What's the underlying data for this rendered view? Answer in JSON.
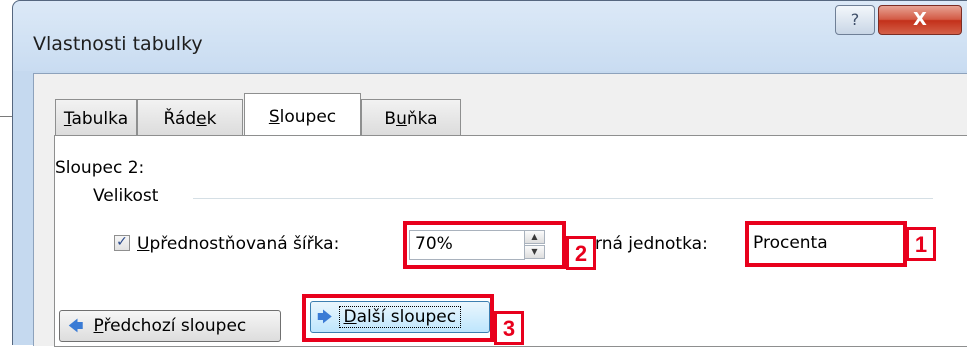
{
  "window": {
    "title": "Vlastnosti tabulky",
    "help_glyph": "?",
    "close_glyph": "X"
  },
  "tabs": [
    {
      "label": "Tabulka",
      "hotkey_index": 0,
      "active": false
    },
    {
      "label": "Řádek",
      "hotkey_index": 3,
      "active": false
    },
    {
      "label": "Sloupec",
      "hotkey_index": 0,
      "active": true
    },
    {
      "label": "Buňka",
      "hotkey_index": 1,
      "active": false
    }
  ],
  "tab_text": {
    "t0": {
      "a": "",
      "u": "T",
      "b": "abulka"
    },
    "t1": {
      "a": "Řád",
      "u": "e",
      "b": "k"
    },
    "t2": {
      "a": "",
      "u": "S",
      "b": "loupec"
    },
    "t3": {
      "a": "B",
      "u": "u",
      "b": "ňka"
    }
  },
  "panel": {
    "column_label": "Sloupec 2:",
    "group_label": "Velikost",
    "preferred_width": {
      "checked": true,
      "label_pre": "",
      "label_u": "U",
      "label_post": "přednostňovaná šířka:",
      "value": "70%"
    },
    "unit": {
      "label": "rná jednotka:",
      "value": "Procenta"
    },
    "prev_button": {
      "u": "P",
      "rest": "ředchozí sloupec"
    },
    "next_button": {
      "u": "D",
      "rest": "alší sloupec"
    }
  },
  "annotations": [
    {
      "number": "1",
      "target": "unit-select"
    },
    {
      "number": "2",
      "target": "preferred-width-input"
    },
    {
      "number": "3",
      "target": "next-column-button"
    }
  ],
  "colors": {
    "highlight": "#e8001c",
    "title_bar": "#c5d9ef",
    "close_button": "#c3301a"
  }
}
